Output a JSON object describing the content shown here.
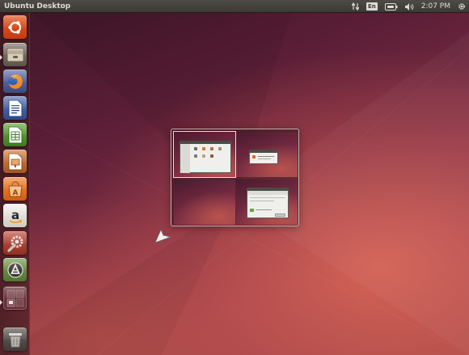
{
  "top_panel": {
    "title": "Ubuntu Desktop",
    "indicators": {
      "network_icon": "network-updown-icon",
      "keyboard_layout": "En",
      "battery_icon": "battery-icon",
      "volume_icon": "volume-icon",
      "clock": "2:07 PM",
      "settings_icon": "gear-icon"
    }
  },
  "launcher": {
    "items": [
      {
        "name": "dash-home",
        "icon": "ubuntu-logo-icon"
      },
      {
        "name": "files",
        "icon": "file-cabinet-icon"
      },
      {
        "name": "firefox",
        "icon": "firefox-icon"
      },
      {
        "name": "libreoffice-writer",
        "icon": "writer-document-icon"
      },
      {
        "name": "libreoffice-calc",
        "icon": "calc-spreadsheet-icon"
      },
      {
        "name": "libreoffice-impress",
        "icon": "impress-presentation-icon"
      },
      {
        "name": "ubuntu-software-center",
        "icon": "software-center-icon"
      },
      {
        "name": "amazon",
        "icon": "amazon-icon"
      },
      {
        "name": "system-settings",
        "icon": "settings-wrench-icon"
      },
      {
        "name": "software-updater",
        "icon": "updater-icon"
      },
      {
        "name": "workspace-switcher",
        "icon": "workspace-switcher-icon"
      },
      {
        "name": "trash",
        "icon": "trash-icon"
      }
    ],
    "glyphs": {
      "amazon": "a",
      "software_center": "A"
    }
  },
  "workspace_switcher": {
    "workspaces": 4,
    "active_workspace": 1
  },
  "colors": {
    "panel": "#3b3a36",
    "ubuntu_orange": "#dd4814",
    "wallpaper_aubergine": "#5a1e36"
  }
}
